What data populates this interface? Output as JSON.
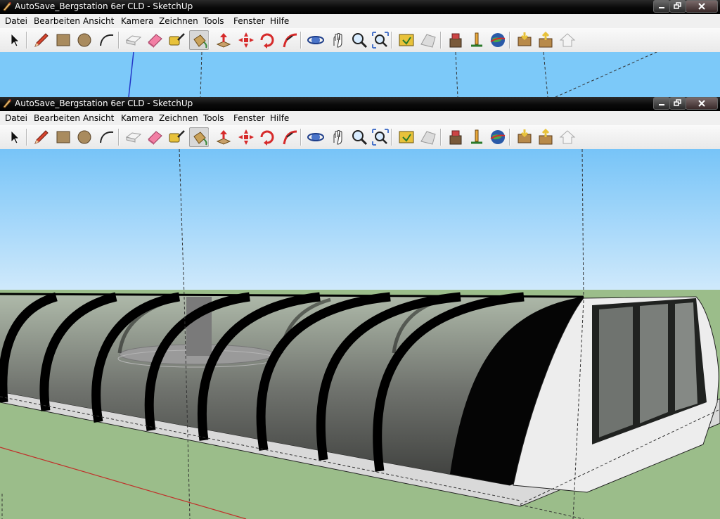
{
  "app": {
    "window_title": "AutoSave_Bergstation 6er CLD - SketchUp"
  },
  "menu": {
    "items": [
      "Datei",
      "Bearbeiten",
      "Ansicht",
      "Kamera",
      "Zeichnen",
      "Tools",
      "Fenster",
      "Hilfe"
    ]
  },
  "toolbar": {
    "tools": [
      {
        "name": "select-icon",
        "pressed": false
      },
      {
        "name": "pencil-icon",
        "pressed": false
      },
      {
        "name": "rectangle-icon",
        "pressed": false
      },
      {
        "name": "circle-icon",
        "pressed": false
      },
      {
        "name": "arc-icon",
        "pressed": false
      },
      {
        "name": "make-component-icon",
        "pressed": false
      },
      {
        "name": "eraser-icon",
        "pressed": false
      },
      {
        "name": "tape-measure-icon",
        "pressed": false
      },
      {
        "name": "paint-bucket-icon",
        "pressed": true
      },
      {
        "name": "push-pull-icon",
        "pressed": false
      },
      {
        "name": "move-icon",
        "pressed": false
      },
      {
        "name": "rotate-icon",
        "pressed": false
      },
      {
        "name": "follow-me-icon",
        "pressed": false
      },
      {
        "name": "orbit-icon",
        "pressed": false
      },
      {
        "name": "pan-icon",
        "pressed": false
      },
      {
        "name": "zoom-icon",
        "pressed": false
      },
      {
        "name": "zoom-extents-icon",
        "pressed": false
      },
      {
        "name": "get-photo-texture-icon",
        "pressed": false
      },
      {
        "name": "toggle-terrain-icon",
        "pressed": false
      },
      {
        "name": "add-location-icon",
        "pressed": false
      },
      {
        "name": "place-model-icon",
        "pressed": false
      },
      {
        "name": "google-earth-icon",
        "pressed": false
      },
      {
        "name": "get-models-icon",
        "pressed": false
      },
      {
        "name": "share-model-icon",
        "pressed": false
      },
      {
        "name": "share-component-icon",
        "pressed": false
      }
    ]
  },
  "colors": {
    "sky": "#7cc9f9",
    "ground": "#9bbd8a",
    "titlebar": "#000000",
    "red_axis": "#c0302a",
    "blue_axis": "#2336c8"
  }
}
